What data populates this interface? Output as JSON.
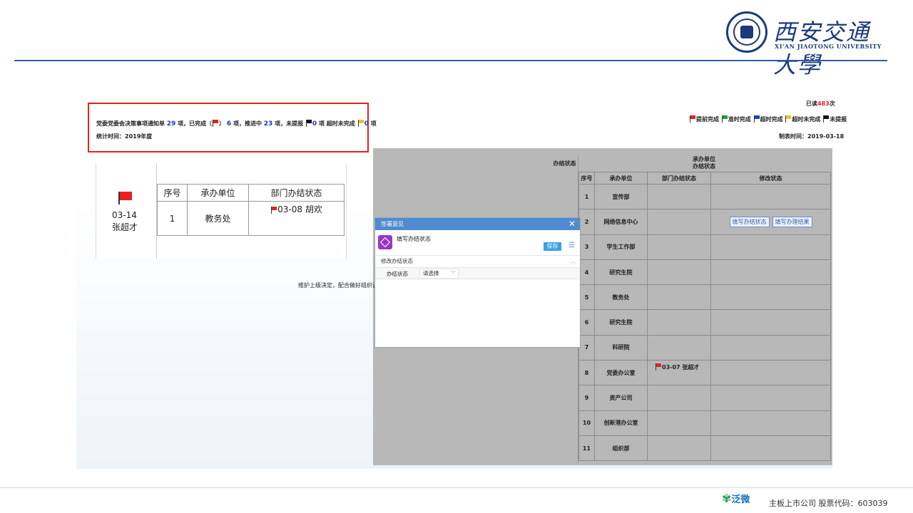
{
  "header": {
    "university_cn": "西安交通大學",
    "university_en": "XI'AN JIAOTONG UNIVERSITY"
  },
  "summary": {
    "text1": "党委党委会决策事项通知单",
    "count_total": "29",
    "text2": "项，已完成（",
    "text3": "）",
    "count_done": "6",
    "text4": "项，推进中",
    "count_progress": "23",
    "text5": "项，未提报",
    "count_unreported": "0",
    "text6": "项 超时未完成",
    "count_overdue": "0",
    "text7": "项",
    "stat_time": "统计时间：2019年度"
  },
  "right_header": {
    "read_prefix": "已读",
    "read_count": "483",
    "read_suffix": "次",
    "legend": [
      "提前完成",
      "准时完成",
      "超时完成",
      "超时未完成",
      "未提报"
    ],
    "made_date": "制表时间：2019-03-18"
  },
  "colors": {
    "red_flag": "#e8211d",
    "green_flag": "#1e9e3a",
    "blue_flag": "#1f3fb8",
    "yellow_flag": "#f0c419",
    "black_flag": "#111111"
  },
  "cutout": {
    "date": "03-14",
    "person": "张超才",
    "headers": [
      "序号",
      "承办单位",
      "部门办结状态"
    ],
    "row": {
      "no": "1",
      "unit": "教务处",
      "status": "03-08 胡欢"
    }
  },
  "right_table": {
    "state_col": "办结状态",
    "top_head_line1": "承办单位",
    "top_head_line2": "办结状态",
    "headers": [
      "序号",
      "承办单位",
      "部门办结状态",
      "修改状态"
    ],
    "rows": [
      {
        "no": "1",
        "unit": "宣传部",
        "status": "",
        "actions": []
      },
      {
        "no": "2",
        "unit": "网络信息中心",
        "status": "",
        "actions": [
          "填写办结状态",
          "填写办理结果"
        ]
      },
      {
        "no": "3",
        "unit": "学生工作部",
        "status": "",
        "actions": []
      },
      {
        "no": "4",
        "unit": "研究生院",
        "status": "",
        "actions": []
      },
      {
        "no": "5",
        "unit": "教务处",
        "status": "",
        "actions": []
      },
      {
        "no": "6",
        "unit": "研究生院",
        "status": "",
        "actions": []
      },
      {
        "no": "7",
        "unit": "科研院",
        "status": "",
        "actions": []
      },
      {
        "no": "8",
        "unit": "党委办公室",
        "status": "03-07 张超才",
        "actions": []
      },
      {
        "no": "9",
        "unit": "资产公司",
        "status": "",
        "actions": []
      },
      {
        "no": "10",
        "unit": "创新港办公室",
        "status": "",
        "actions": []
      },
      {
        "no": "11",
        "unit": "组织部",
        "status": "",
        "actions": []
      }
    ]
  },
  "gray_left_text": "维护上级决定，配合做好组织调查工作。",
  "modal": {
    "title": "签署意见",
    "app_title": "填写办结状态",
    "save_label": "保存",
    "section": "修改办结状态",
    "field_label": "办结状态",
    "select_value": "请选择"
  },
  "footer": {
    "brand": "泛微",
    "text": "主板上市公司  股票代码：603039"
  }
}
